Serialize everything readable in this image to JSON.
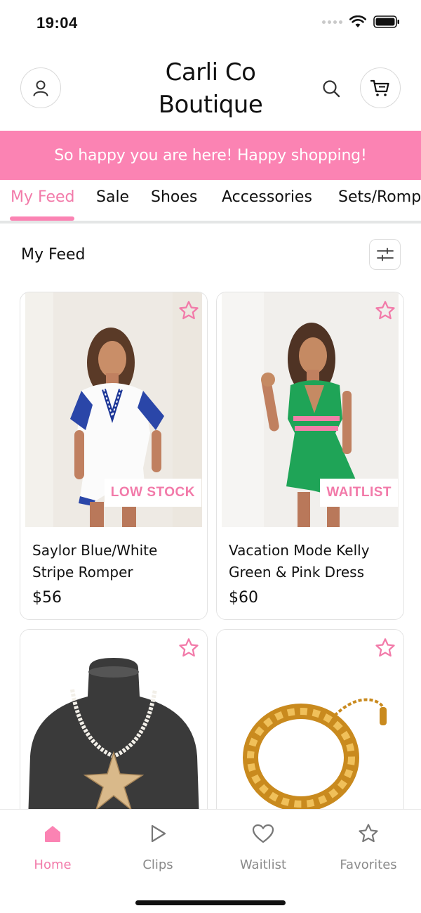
{
  "status_bar": {
    "time": "19:04"
  },
  "header": {
    "title_line1": "Carli Co",
    "title_line2": "Boutique",
    "profile_icon": "user-icon",
    "search_icon": "search-icon",
    "cart_icon": "cart-icon"
  },
  "banner": {
    "text": "So happy you are here! Happy shopping!",
    "color": "#fb83b3"
  },
  "tabs": [
    {
      "label": "My Feed",
      "active": true
    },
    {
      "label": "Sale"
    },
    {
      "label": "Shoes"
    },
    {
      "label": "Accessories"
    },
    {
      "label": "Sets/Romp"
    }
  ],
  "feed": {
    "title": "My Feed",
    "filter_icon": "sliders-icon"
  },
  "products": [
    {
      "name": "Saylor Blue/White Stripe Romper",
      "price": "$56",
      "badge": "LOW STOCK"
    },
    {
      "name": "Vacation Mode Kelly Green & Pink Dress",
      "price": "$60",
      "badge": "WAITLIST"
    },
    {
      "name": "",
      "price": "",
      "badge": ""
    },
    {
      "name": "",
      "price": "",
      "badge": ""
    }
  ],
  "bottom_nav": [
    {
      "label": "Home",
      "icon": "home-icon",
      "active": true
    },
    {
      "label": "Clips",
      "icon": "play-icon"
    },
    {
      "label": "Waitlist",
      "icon": "heart-icon"
    },
    {
      "label": "Favorites",
      "icon": "star-icon"
    }
  ],
  "colors": {
    "accent": "#fb83b3",
    "accent_text": "#f27aa9"
  }
}
